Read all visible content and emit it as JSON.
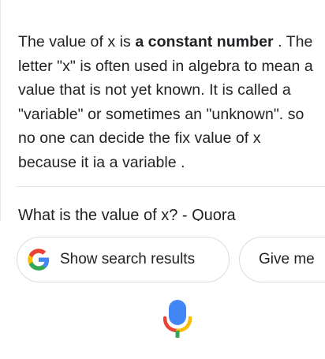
{
  "answer": {
    "prefix": "The value of x is ",
    "bold": "a constant number",
    "rest": " . The letter \"x\" is often used in algebra to mean a value that is not yet known. It is called a \"variable\" or sometimes an \"unknown\". so no one can decide the fix value of x because it ia a variable ."
  },
  "source": {
    "title": "What is the value of x? - Quora"
  },
  "chips": {
    "show_search_results": "Show search results",
    "give_me": "Give me"
  },
  "icons": {
    "google_logo": "google-g-logo",
    "mic": "google-mic-icon"
  },
  "colors": {
    "google_blue": "#4285F4",
    "google_red": "#EA4335",
    "google_yellow": "#FBBC05",
    "google_green": "#34A853",
    "chip_border": "#dadce0",
    "text": "#222222"
  }
}
